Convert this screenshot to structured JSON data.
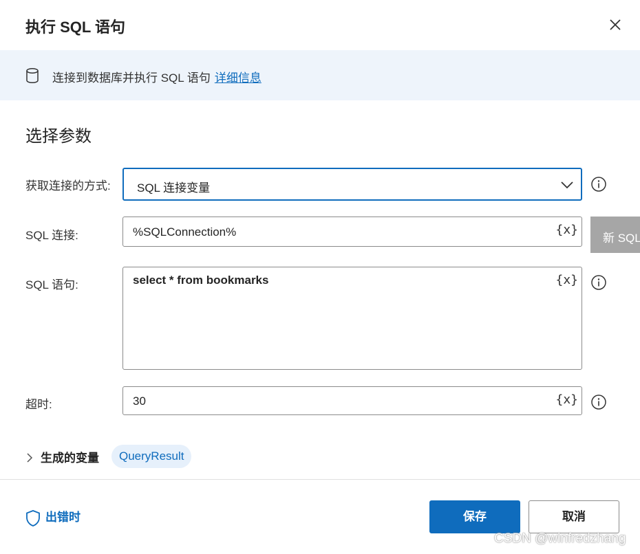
{
  "dialog": {
    "title": "执行 SQL 语句",
    "close_icon": "close-icon"
  },
  "banner": {
    "icon": "database-icon",
    "description": "连接到数据库并执行 SQL 语句",
    "link_text": "详细信息"
  },
  "section": {
    "title": "选择参数"
  },
  "fields": {
    "connection_mode": {
      "label": "获取连接的方式:",
      "value": "SQL 连接变量",
      "icon": "chevron-down-icon"
    },
    "sql_connection": {
      "label": "SQL 连接:",
      "value": "%SQLConnection%",
      "var_button": "{x}"
    },
    "sql_statement": {
      "label": "SQL 语句:",
      "value": "select * from bookmarks",
      "var_button": "{x}"
    },
    "timeout": {
      "label": "超时:",
      "value": "30",
      "var_button": "{x}"
    }
  },
  "new_sql_button": "新 SQL",
  "generated_vars": {
    "label": "生成的变量",
    "chip": "QueryResult"
  },
  "footer": {
    "on_error": "出错时",
    "save": "保存",
    "cancel": "取消"
  },
  "watermark": "CSDN @winfredzhang",
  "colors": {
    "accent": "#0f6cbd",
    "banner_bg": "#eef4fb",
    "chip_bg": "#e6f0fb",
    "overlay_button_bg": "#a6a6a6"
  }
}
